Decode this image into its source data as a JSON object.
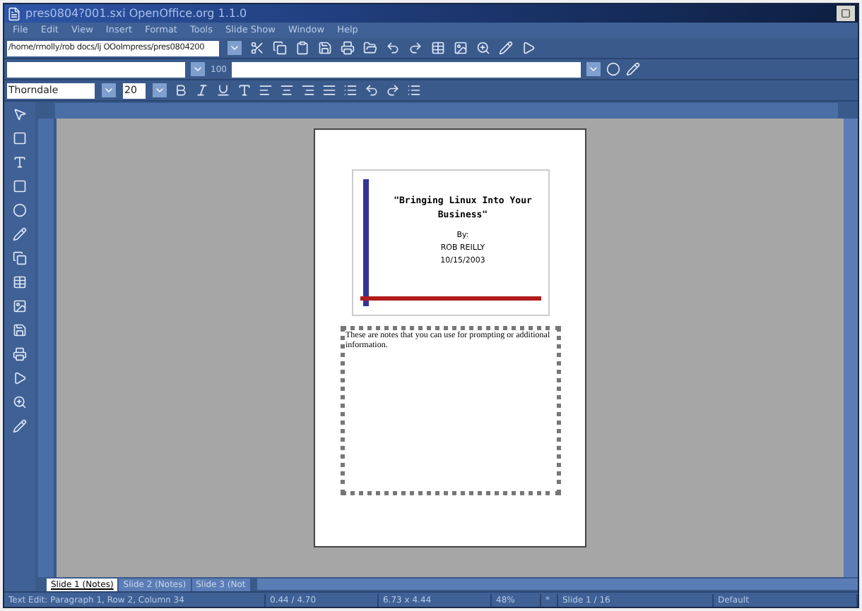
{
  "window": {
    "title": "pres0804?001.sxi   OpenOffice.org 1.1.0"
  },
  "menu": [
    "File",
    "Edit",
    "View",
    "Insert",
    "Format",
    "Tools",
    "Slide Show",
    "Window",
    "Help"
  ],
  "url_bar": {
    "value": "/home/rmolly/rob docs/lj OOoImpress/pres0804200"
  },
  "function_bar": {
    "zoom_label": "100"
  },
  "formatting": {
    "font": "Thorndale",
    "size": "20"
  },
  "slide": {
    "title": "\"Bringing Linux Into Your Business\"",
    "by": "By:",
    "author": "ROB REILLY",
    "date": "10/15/2003"
  },
  "notes": {
    "text": "These are notes that you can use for prompting or additional information."
  },
  "tabs": [
    {
      "label": "Slide 1 (Notes)",
      "selected": true
    },
    {
      "label": "Slide 2 (Notes)",
      "selected": false
    },
    {
      "label": "Slide 3 (Not",
      "selected": false
    }
  ],
  "status_bar": [
    "Text Edit: Paragraph 1, Row 2, Column 34",
    "0.44 / 4.70",
    "6.73 x 4.44",
    "48%",
    "*",
    "Slide 1 / 16",
    "Default"
  ]
}
